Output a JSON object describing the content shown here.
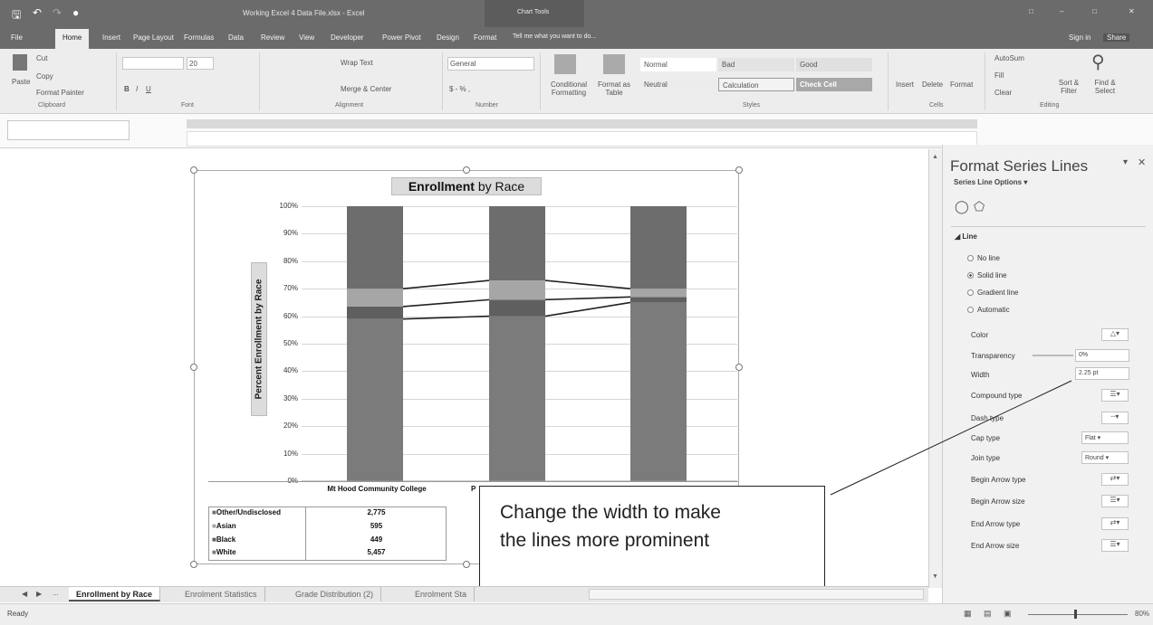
{
  "window": {
    "title": "Working Excel 4 Data File.xlsx - Excel",
    "context_tab": "Chart Tools",
    "controls": [
      "□",
      "–",
      "□",
      "✕"
    ]
  },
  "tabs": {
    "file": "File",
    "home": "Home",
    "insert": "Insert",
    "page_layout": "Page Layout",
    "formulas": "Formulas",
    "data": "Data",
    "review": "Review",
    "view": "View",
    "developer": "Developer",
    "power_pivot": "Power Pivot",
    "design": "Design",
    "format": "Format",
    "tell_me": "Tell me what you want to do...",
    "sign_in": "Sign in",
    "share": "Share"
  },
  "ribbon": {
    "cut": "Cut",
    "copy": "Copy",
    "format_painter": "Format Painter",
    "paste": "Paste",
    "clipboard": "Clipboard",
    "font_size": "20",
    "font": "Font",
    "wrap_text": "Wrap Text",
    "merge_center": "Merge & Center",
    "alignment": "Alignment",
    "number_format": "General",
    "number": "Number",
    "conditional_formatting": "Conditional Formatting",
    "format_as_table": "Format as Table",
    "styles": "Styles",
    "style_normal": "Normal",
    "style_bad": "Bad",
    "style_good": "Good",
    "style_neutral": "Neutral",
    "style_calculation": "Calculation",
    "style_check_cell": "Check Cell",
    "insert": "Insert",
    "delete": "Delete",
    "format": "Format",
    "cells": "Cells",
    "autosum": "AutoSum",
    "fill": "Fill",
    "clear": "Clear",
    "sort_filter": "Sort & Filter",
    "find_select": "Find & Select",
    "editing": "Editing"
  },
  "chart_data": {
    "type": "bar",
    "stacked": true,
    "percent_stacked": true,
    "title_bold": "Enrollment",
    "title_rest": " by Race",
    "ylabel": "Percent Enrollment by Race",
    "yticks": [
      "100%",
      "90%",
      "80%",
      "70%",
      "60%",
      "50%",
      "40%",
      "30%",
      "20%",
      "10%",
      "0%"
    ],
    "ylim": [
      0,
      100
    ],
    "categories": [
      "Mt Hood Community College",
      "P",
      ""
    ],
    "series": [
      {
        "name": "White",
        "color": "#7b7b7b",
        "values": [
          59,
          60,
          65
        ],
        "table": [
          "5,457",
          "",
          ""
        ]
      },
      {
        "name": "Black",
        "color": "#5f5f5f",
        "values": [
          4.5,
          6,
          2
        ],
        "table": [
          "449",
          "",
          ""
        ]
      },
      {
        "name": "Asian",
        "color": "#a6a6a6",
        "values": [
          6.5,
          7,
          3
        ],
        "table": [
          "595",
          "",
          ""
        ]
      },
      {
        "name": "Other/Undisclosed",
        "color": "#6d6d6d",
        "values": [
          30,
          27,
          30
        ],
        "table": [
          "2,775",
          "",
          ""
        ]
      }
    ],
    "grid": true,
    "series_lines": true
  },
  "pane": {
    "title": "Format Series Lines",
    "options": "Series Line Options",
    "section": "Line",
    "radio": [
      "No line",
      "Solid line",
      "Gradient line",
      "Automatic"
    ],
    "selected_radio": 1,
    "color": "Color",
    "transparency": "Transparency",
    "transparency_value": "0%",
    "width": "Width",
    "width_value": "2.25 pt",
    "compound_type": "Compound type",
    "dash_type": "Dash type",
    "cap_type": "Cap type",
    "cap_value": "Flat",
    "join_type": "Join type",
    "join_value": "Round",
    "begin_arrow_type": "Begin Arrow type",
    "begin_arrow_size": "Begin Arrow size",
    "end_arrow_type": "End Arrow type",
    "end_arrow_size": "End Arrow size"
  },
  "callout": {
    "line1": "Change the width to make",
    "line2": "the lines more prominent"
  },
  "sheets": [
    "Enrollment by Race",
    "Enrolment Statistics",
    "Grade Distribution (2)",
    "Enrolment Sta"
  ],
  "status": {
    "ready": "Ready",
    "zoom": "80%"
  }
}
